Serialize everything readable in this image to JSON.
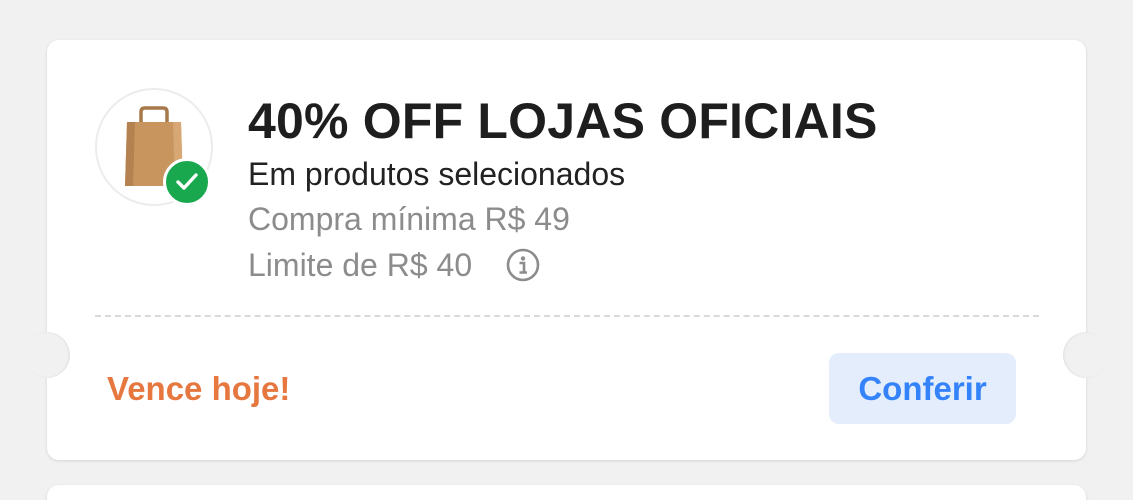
{
  "coupon": {
    "title": "40% OFF LOJAS OFICIAIS",
    "subtitle": "Em produtos selecionados",
    "min_purchase": "Compra mínima R$ 49",
    "limit": "Limite de R$ 40",
    "expires": "Vence hoje!",
    "action_label": "Conferir",
    "image_icon": "shopping-bag-icon",
    "badge_icon": "check-icon",
    "info_icon": "info-icon"
  },
  "colors": {
    "expires": "#e5773f",
    "action_text": "#3483fa",
    "action_bg": "#e3edfc",
    "badge": "#1aa84f"
  }
}
